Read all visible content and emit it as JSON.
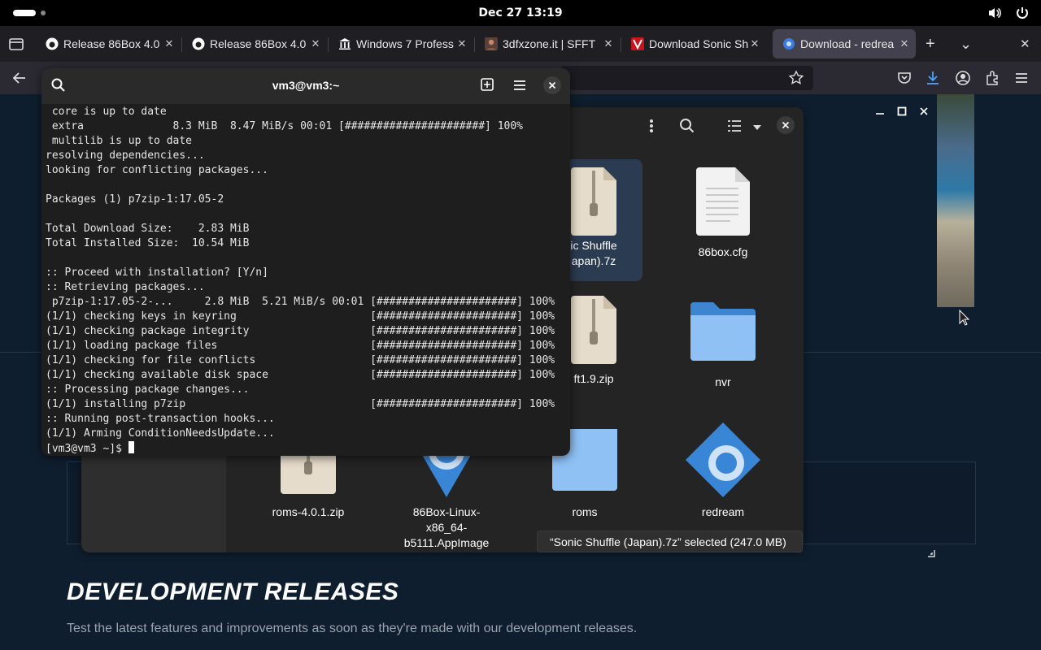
{
  "topbar": {
    "clock": "Dec 27  13:19"
  },
  "browser": {
    "tabs": [
      {
        "title": "Release 86Box 4.0",
        "favicon": "github-icon",
        "active": false
      },
      {
        "title": "Release 86Box 4.0",
        "favicon": "github-icon",
        "active": false
      },
      {
        "title": "Windows 7 Profess",
        "favicon": "archive-icon",
        "active": false
      },
      {
        "title": "3dfxzone.it | SFFT",
        "favicon": "avatar-icon",
        "active": false
      },
      {
        "title": "Download Sonic Sh",
        "favicon": "v-logo-icon",
        "active": false
      },
      {
        "title": "Download - redrea",
        "favicon": "redream-icon",
        "active": true
      }
    ],
    "new_tab": "+",
    "tab_overflow": "⌄",
    "close_window": "✕"
  },
  "webpage": {
    "heading": "DEVELOPMENT RELEASES",
    "subheading": "Test the latest features and improvements as soon as they're made with our development releases."
  },
  "files": {
    "items": [
      {
        "label": "ic Shuffle\napan).7z",
        "kind": "zip",
        "selected": true
      },
      {
        "label": "86box.cfg",
        "kind": "text",
        "selected": false
      },
      {
        "label": "ft1.9.zip",
        "kind": "zip",
        "selected": false
      },
      {
        "label": "nvr",
        "kind": "folder",
        "selected": false
      },
      {
        "label": "roms-4.0.1.zip",
        "kind": "zip",
        "selected": false
      },
      {
        "label": "86Box-Linux-\nx86_64-\nb5111.AppImage",
        "kind": "gear",
        "selected": false
      },
      {
        "label": "roms",
        "kind": "folder",
        "selected": false
      },
      {
        "label": "redream",
        "kind": "gear",
        "selected": false
      }
    ],
    "status": "“Sonic Shuffle (Japan).7z” selected  (247.0 MB)"
  },
  "terminal": {
    "title": "vm3@vm3:~",
    "lines": [
      " core is up to date",
      " extra              8.3 MiB  8.47 MiB/s 00:01 [######################] 100%",
      " multilib is up to date",
      "resolving dependencies...",
      "looking for conflicting packages...",
      "",
      "Packages (1) p7zip-1:17.05-2",
      "",
      "Total Download Size:    2.83 MiB",
      "Total Installed Size:  10.54 MiB",
      "",
      ":: Proceed with installation? [Y/n]",
      ":: Retrieving packages...",
      " p7zip-1:17.05-2-...     2.8 MiB  5.21 MiB/s 00:01 [######################] 100%",
      "(1/1) checking keys in keyring                     [######################] 100%",
      "(1/1) checking package integrity                   [######################] 100%",
      "(1/1) loading package files                        [######################] 100%",
      "(1/1) checking for file conflicts                  [######################] 100%",
      "(1/1) checking available disk space                [######################] 100%",
      ":: Processing package changes...",
      "(1/1) installing p7zip                             [######################] 100%",
      ":: Running post-transaction hooks...",
      "(1/1) Arming ConditionNeedsUpdate..."
    ],
    "prompt": "[vm3@vm3 ~]$ "
  }
}
